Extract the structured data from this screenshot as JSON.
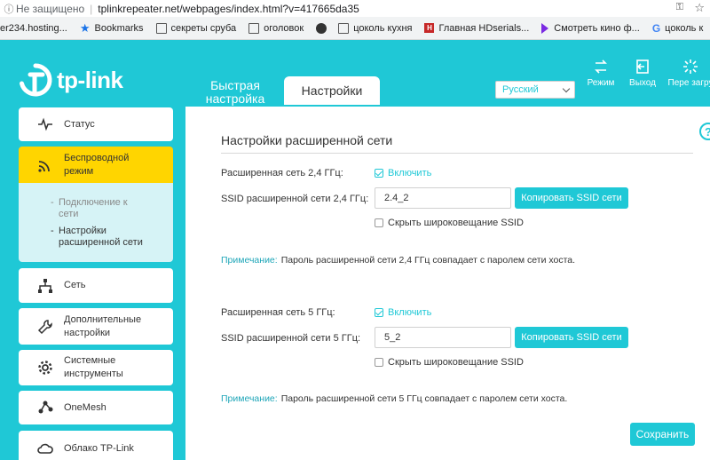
{
  "browser": {
    "security_label": "Не защищено",
    "url": "tplinkrepeater.net/webpages/index.html?v=417665da35",
    "bookmarks": [
      {
        "label": "er234.hosting..."
      },
      {
        "label": "Bookmarks"
      },
      {
        "label": "секреты сруба"
      },
      {
        "label": "оголовок"
      },
      {
        "label": "цоколь кухня"
      },
      {
        "label": "Главная HDserials..."
      },
      {
        "label": "Смотреть кино ф..."
      },
      {
        "label": "цоколь к"
      }
    ]
  },
  "header": {
    "logo_text": "tp-link",
    "tab_quick": "Быстрая настройка",
    "tab_settings": "Настройки",
    "language": "Русский",
    "buttons": {
      "mode": "Режим",
      "logout": "Выход",
      "reboot": "Пере загру"
    }
  },
  "sidebar": {
    "items": [
      {
        "label": "Статус"
      },
      {
        "label": "Беспроводной режим"
      },
      {
        "label": "Сеть"
      },
      {
        "label": "Дополнительные настройки"
      },
      {
        "label": "Системные инструменты"
      },
      {
        "label": "OneMesh"
      },
      {
        "label": "Облако TP-Link"
      }
    ],
    "subitems": [
      {
        "label": "Подключение к сети"
      },
      {
        "label": "Настройки расширенной сети"
      }
    ]
  },
  "main": {
    "title": "Настройки расширенной сети",
    "band24": {
      "network_label": "Расширенная сеть 2,4 ГГц:",
      "enable_label": "Включить",
      "ssid_label": "SSID расширенной сети 2,4 ГГц:",
      "ssid_value": "2.4_2",
      "copy_label": "Копировать SSID сети",
      "hide_label": "Скрыть широковещание SSID",
      "note_key": "Примечание:",
      "note_text": "Пароль расширенной сети 2,4 ГГц совпадает с паролем сети хоста."
    },
    "band5": {
      "network_label": "Расширенная сеть 5 ГГц:",
      "enable_label": "Включить",
      "ssid_label": "SSID расширенной сети 5 ГГц:",
      "ssid_value": "5_2",
      "copy_label": "Копировать SSID сети",
      "hide_label": "Скрыть широковещание SSID",
      "note_key": "Примечание:",
      "note_text": "Пароль расширенной сети 5 ГГц совпадает с паролем сети хоста."
    },
    "save_label": "Сохранить"
  }
}
